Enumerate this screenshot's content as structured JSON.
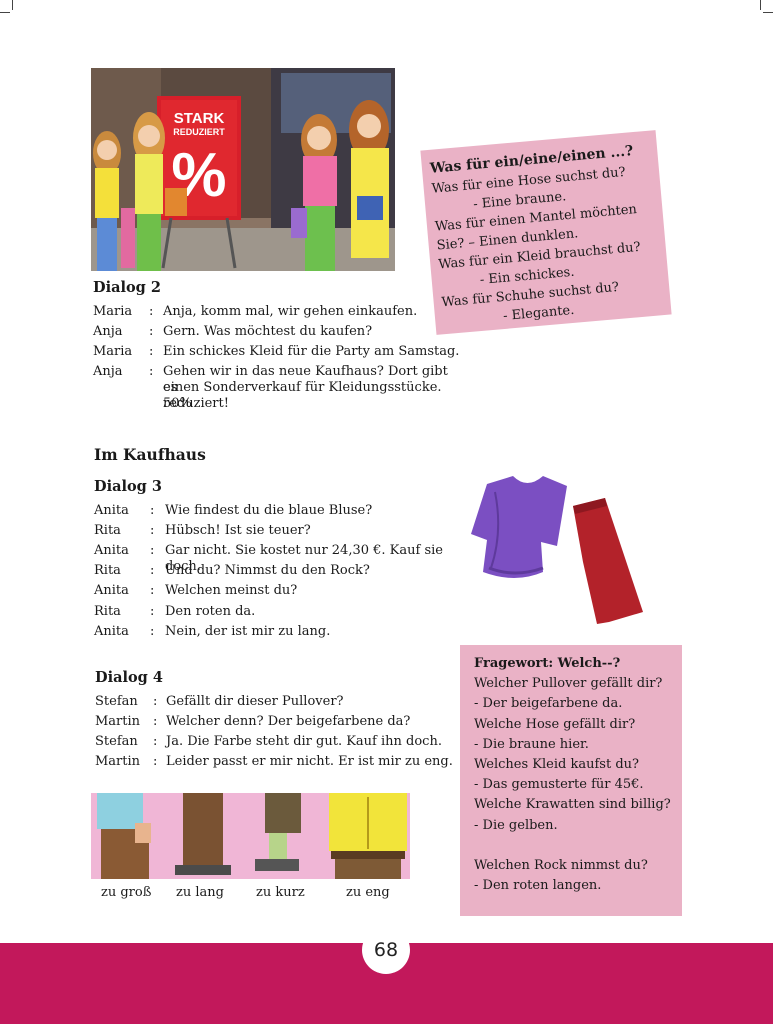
{
  "page_number": "68",
  "shop_sign": {
    "line1": "STARK",
    "line2": "REDUZIERT",
    "symbol": "%"
  },
  "dialog2": {
    "title": "Dialog 2",
    "lines": [
      {
        "speaker": "Maria",
        "text": "Anja, komm mal, wir gehen einkaufen."
      },
      {
        "speaker": "Anja",
        "text": "Gern. Was möchtest du kaufen?"
      },
      {
        "speaker": "Maria",
        "text": "Ein schickes Kleid für die Party am Samstag."
      },
      {
        "speaker": "Anja",
        "text": "Gehen wir in das neue Kaufhaus? Dort gibt es",
        "text2": "einen Sonderverkauf für Kleidungsstücke. 50%",
        "text3": "reduziert!"
      }
    ]
  },
  "section_title": "Im Kaufhaus",
  "dialog3": {
    "title": "Dialog 3",
    "lines": [
      {
        "speaker": "Anita",
        "text": "Wie findest du die blaue Bluse?"
      },
      {
        "speaker": "Rita",
        "text": "Hübsch! Ist sie teuer?"
      },
      {
        "speaker": "Anita",
        "text": "Gar nicht. Sie kostet nur 24,30 €. Kauf sie doch."
      },
      {
        "speaker": "Rita",
        "text": "Und du? Nimmst du den Rock?"
      },
      {
        "speaker": "Anita",
        "text": "Welchen meinst du?"
      },
      {
        "speaker": "Rita",
        "text": "Den roten da."
      },
      {
        "speaker": "Anita",
        "text": "Nein, der ist mir zu lang."
      }
    ]
  },
  "dialog4": {
    "title": "Dialog 4",
    "lines": [
      {
        "speaker": "Stefan",
        "text": "Gefällt dir dieser Pullover?"
      },
      {
        "speaker": "Martin",
        "text": "Welcher denn? Der beigefarbene da?"
      },
      {
        "speaker": "Stefan",
        "text": "Ja. Die Farbe steht dir gut. Kauf ihn doch."
      },
      {
        "speaker": "Martin",
        "text": "Leider passt er mir nicht. Er ist mir zu eng."
      }
    ]
  },
  "note_box": {
    "title": "Was für ein/eine/einen ...?",
    "lines": [
      "Was für eine Hose suchst du?",
      "-   Eine braune.",
      "Was für einen Mantel möchten",
      "Sie? – Einen dunklen.",
      "Was für ein Kleid brauchst du?",
      "-   Ein schickes.",
      "Was für Schuhe suchst du?",
      "- Elegante."
    ]
  },
  "frage_box": {
    "title": "Fragewort: Welch--?",
    "lines": [
      "Welcher Pullover gefällt dir?",
      "- Der beigefarbene da.",
      "Welche Hose gefällt dir?",
      "- Die braune hier.",
      "Welches Kleid kaufst du?",
      "- Das gemusterte für 45€.",
      "Welche Krawatten sind billig?",
      "- Die gelben.",
      "",
      "Welchen Rock nimmst du?",
      "- Den roten langen."
    ]
  },
  "leg_labels": [
    "zu groß",
    "zu lang",
    "zu kurz",
    "zu eng"
  ],
  "colors": {
    "footer": "#c2185b",
    "note_pink": "#eab2c6",
    "blouse": "#7b4fc2",
    "skirt": "#b3222a"
  }
}
